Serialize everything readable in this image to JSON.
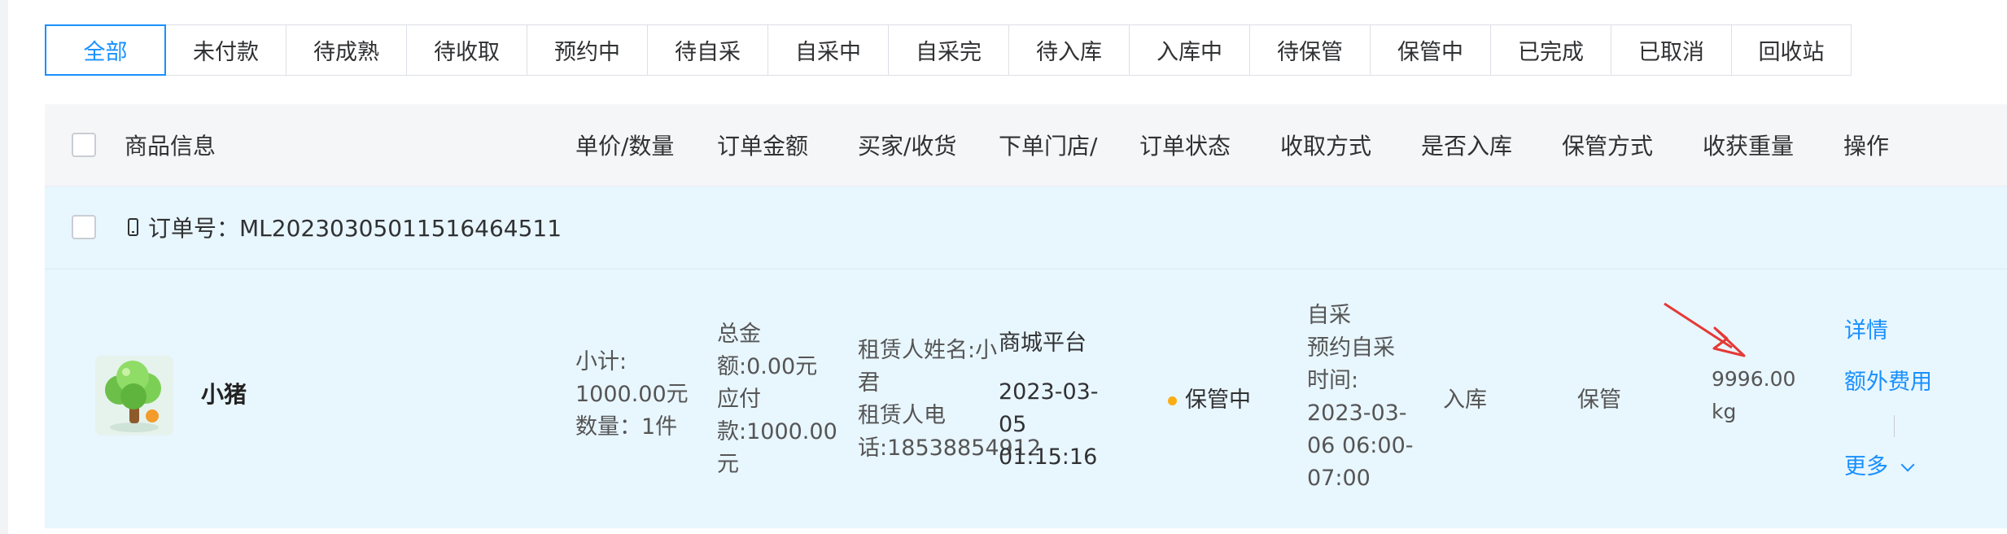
{
  "tabs": [
    {
      "label": "全部",
      "active": true
    },
    {
      "label": "未付款"
    },
    {
      "label": "待成熟"
    },
    {
      "label": "待收取"
    },
    {
      "label": "预约中"
    },
    {
      "label": "待自采"
    },
    {
      "label": "自采中"
    },
    {
      "label": "自采完"
    },
    {
      "label": "待入库"
    },
    {
      "label": "入库中"
    },
    {
      "label": "待保管"
    },
    {
      "label": "保管中"
    },
    {
      "label": "已完成"
    },
    {
      "label": "已取消"
    },
    {
      "label": "回收站"
    }
  ],
  "table": {
    "headers": {
      "product": "商品信息",
      "price_qty": "单价/数量",
      "amount": "订单金额",
      "buyer": "买家/收货",
      "store": "下单门店/",
      "status": "订单状态",
      "method": "收取方式",
      "stored": "是否入库",
      "custody": "保管方式",
      "weight": "收获重量",
      "ops": "操作"
    },
    "order": {
      "number_label": "订单号：ML20230305011516464511",
      "product_name": "小猪",
      "subtotal_label": "小计:",
      "subtotal_value": "1000.00元",
      "quantity": "数量：1件",
      "amount_lines": [
        "总金",
        "额:0.00元",
        "应付",
        "款:1000.00",
        "元"
      ],
      "buyer_lines": [
        "租赁人姓名:小",
        "君",
        "租赁人电",
        "话:18538854912"
      ],
      "store": "商城平台",
      "created_lines": [
        "2023-03-",
        "05",
        "01:15:16"
      ],
      "status": "保管中",
      "method_lines": [
        "自采",
        "预约自采",
        "时间:",
        "2023-03-",
        "06 06:00-",
        "07:00"
      ],
      "stored": "入库",
      "custody": "保管",
      "weight_lines": [
        "9996.00",
        "kg"
      ],
      "actions": {
        "detail": "详情",
        "extra_fee": "额外费用",
        "more": "更多"
      }
    }
  },
  "colors": {
    "accent": "#1890ff",
    "row_bg": "#e8f6fe",
    "status_dot": "#faad14",
    "annotation": "#e53935"
  }
}
